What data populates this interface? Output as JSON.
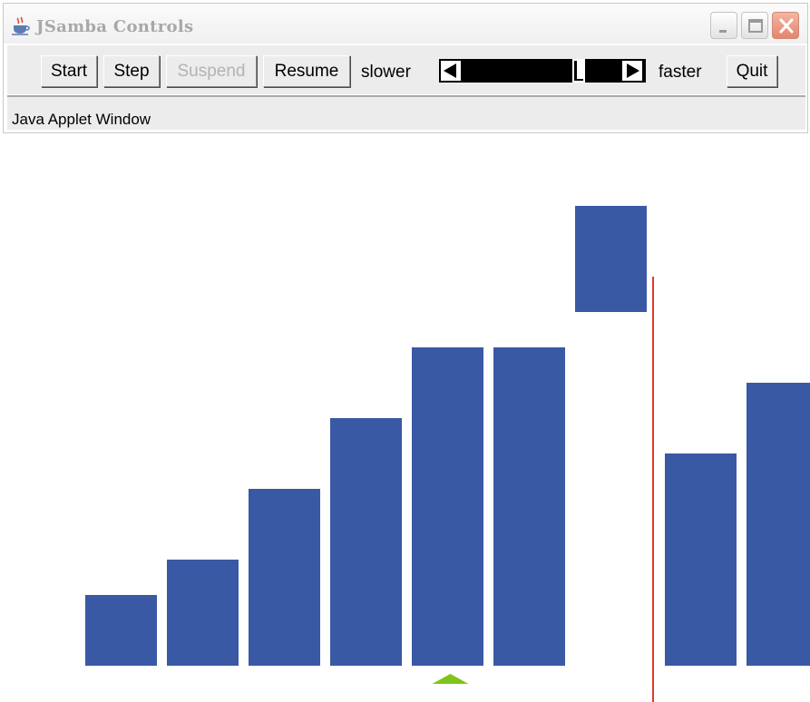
{
  "window": {
    "title": "JSamba Controls",
    "icon": "java-coffee-cup-icon",
    "controls": [
      "minimize-icon",
      "maximize-icon",
      "close-icon"
    ]
  },
  "toolbar": {
    "start_label": "Start",
    "step_label": "Step",
    "suspend_label": "Suspend",
    "resume_label": "Resume",
    "slower_label": "slower",
    "faster_label": "faster",
    "quit_label": "Quit",
    "suspend_enabled": false
  },
  "status": {
    "text": "Java Applet Window"
  },
  "visualization": {
    "bar_color": "#3a59a5",
    "divider_color": "#e23a2a",
    "pointer_color": "#7fc41a",
    "bars": [
      {
        "height": 2
      },
      {
        "height": 3
      },
      {
        "height": 5
      },
      {
        "height": 7
      },
      {
        "height": 9
      },
      {
        "height": 9
      },
      {
        "height": 3,
        "lifted": true
      },
      {
        "height": 6
      },
      {
        "height": 8
      }
    ],
    "lifted_bar_level": 10,
    "divider_after_slot": 6,
    "pointer_at_slot": 4
  }
}
